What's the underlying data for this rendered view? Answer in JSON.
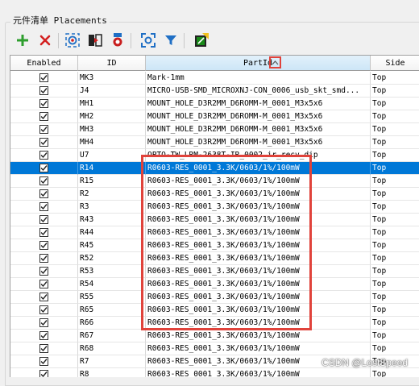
{
  "panel": {
    "title": "元件清单 Placements"
  },
  "toolbar": {
    "buttons": [
      {
        "name": "add-button",
        "icon": "plus-icon",
        "color": "#2e9e2e"
      },
      {
        "name": "delete-button",
        "icon": "x-icon",
        "color": "#d32020"
      },
      {
        "name": "locate-button",
        "icon": "locate-icon",
        "color": "#1f6fc5"
      },
      {
        "name": "swap-button",
        "icon": "swap-icon",
        "color": "#222222"
      },
      {
        "name": "badge-button",
        "icon": "badge-icon",
        "color": "#c81e1e"
      },
      {
        "name": "focus-button",
        "icon": "focus-icon",
        "color": "#1f6fc5"
      },
      {
        "name": "filter-button",
        "icon": "filter-icon",
        "color": "#1f6fc5"
      },
      {
        "name": "import-button",
        "icon": "import-icon",
        "color": "#1a8a1a"
      }
    ]
  },
  "table": {
    "columns": [
      "Enabled",
      "ID",
      "PartId",
      "Side"
    ],
    "sort": {
      "column": "PartId",
      "direction": "ascending"
    },
    "selected_row": "R14",
    "rows": [
      {
        "enabled": true,
        "id": "MK3",
        "part": "Mark-1mm",
        "side": "Top"
      },
      {
        "enabled": true,
        "id": "J4",
        "part": "MICRO-USB-SMD_MICROXNJ-CON_0006_usb_skt_smd...",
        "side": "Top"
      },
      {
        "enabled": true,
        "id": "MH1",
        "part": "MOUNT_HOLE_D3R2MM_D6ROMM-M_0001_M3x5x6",
        "side": "Top"
      },
      {
        "enabled": true,
        "id": "MH2",
        "part": "MOUNT_HOLE_D3R2MM_D6ROMM-M_0001_M3x5x6",
        "side": "Top"
      },
      {
        "enabled": true,
        "id": "MH3",
        "part": "MOUNT_HOLE_D3R2MM_D6ROMM-M_0001_M3x5x6",
        "side": "Top"
      },
      {
        "enabled": true,
        "id": "MH4",
        "part": "MOUNT_HOLE_D3R2MM_D6ROMM-M_0001_M3x5x6",
        "side": "Top"
      },
      {
        "enabled": true,
        "id": "U7",
        "part": "OPTO-TW_LRM-2638T-IR_0002_ir_recv_dip",
        "side": "Top"
      },
      {
        "enabled": true,
        "id": "R14",
        "part": "R0603-RES_0001_3.3K/0603/1%/100mW",
        "side": "Top"
      },
      {
        "enabled": true,
        "id": "R15",
        "part": "R0603-RES_0001_3.3K/0603/1%/100mW",
        "side": "Top"
      },
      {
        "enabled": true,
        "id": "R2",
        "part": "R0603-RES_0001_3.3K/0603/1%/100mW",
        "side": "Top"
      },
      {
        "enabled": true,
        "id": "R3",
        "part": "R0603-RES_0001_3.3K/0603/1%/100mW",
        "side": "Top"
      },
      {
        "enabled": true,
        "id": "R43",
        "part": "R0603-RES_0001_3.3K/0603/1%/100mW",
        "side": "Top"
      },
      {
        "enabled": true,
        "id": "R44",
        "part": "R0603-RES_0001_3.3K/0603/1%/100mW",
        "side": "Top"
      },
      {
        "enabled": true,
        "id": "R45",
        "part": "R0603-RES_0001_3.3K/0603/1%/100mW",
        "side": "Top"
      },
      {
        "enabled": true,
        "id": "R52",
        "part": "R0603-RES_0001_3.3K/0603/1%/100mW",
        "side": "Top"
      },
      {
        "enabled": true,
        "id": "R53",
        "part": "R0603-RES_0001_3.3K/0603/1%/100mW",
        "side": "Top"
      },
      {
        "enabled": true,
        "id": "R54",
        "part": "R0603-RES_0001_3.3K/0603/1%/100mW",
        "side": "Top"
      },
      {
        "enabled": true,
        "id": "R55",
        "part": "R0603-RES_0001_3.3K/0603/1%/100mW",
        "side": "Top"
      },
      {
        "enabled": true,
        "id": "R65",
        "part": "R0603-RES_0001_3.3K/0603/1%/100mW",
        "side": "Top"
      },
      {
        "enabled": true,
        "id": "R66",
        "part": "R0603-RES_0001_3.3K/0603/1%/100mW",
        "side": "Top"
      },
      {
        "enabled": true,
        "id": "R67",
        "part": "R0603-RES_0001_3.3K/0603/1%/100mW",
        "side": "Top"
      },
      {
        "enabled": true,
        "id": "R68",
        "part": "R0603-RES_0001_3.3K/0603/1%/100mW",
        "side": "Top"
      },
      {
        "enabled": true,
        "id": "R7",
        "part": "R0603-RES_0001_3.3K/0603/1%/100mW",
        "side": "Top"
      },
      {
        "enabled": true,
        "id": "R8",
        "part": "R0603-RES_0001_3.3K/0603/1%/100mW",
        "side": "Top"
      }
    ]
  },
  "colors": {
    "selection": "#0078d7",
    "annotation": "#e0433b"
  },
  "watermark": "CSDN @LostSpeed"
}
